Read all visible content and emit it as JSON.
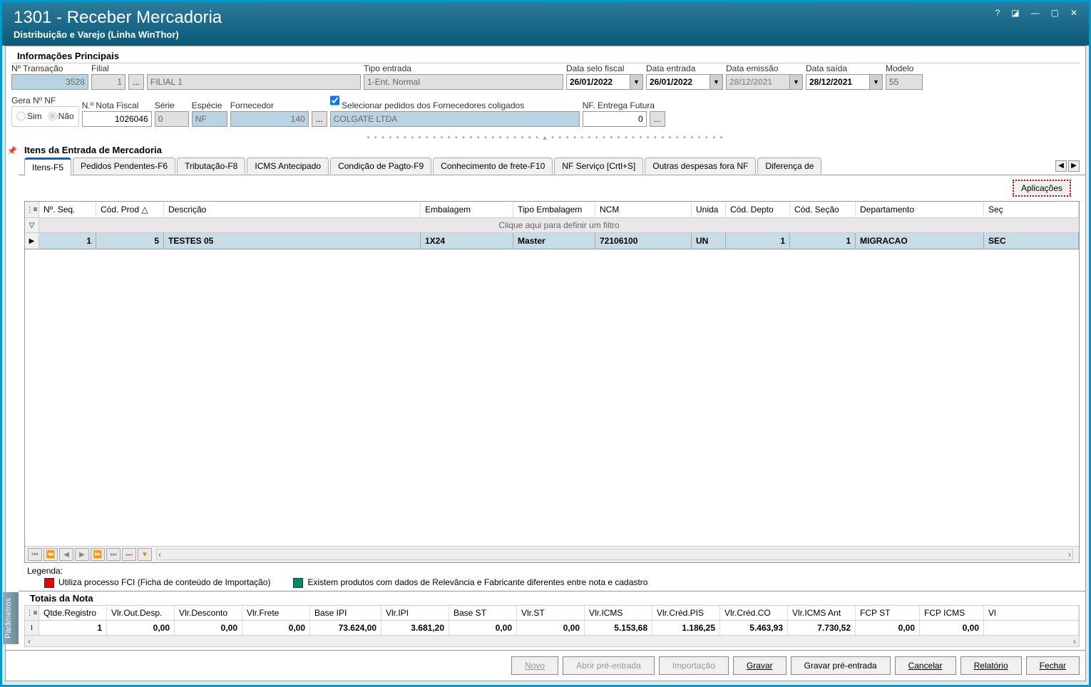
{
  "titlebar": {
    "title": "1301 - Receber Mercadoria",
    "subtitle": "Distribuição e Varejo (Linha WinThor)"
  },
  "info_principais": {
    "section_title": "Informações Principais",
    "labels": {
      "n_transacao": "Nº Transação",
      "filial": "Filial",
      "tipo_entrada": "Tipo entrada",
      "data_selo_fiscal": "Data selo fiscal",
      "data_entrada": "Data entrada",
      "data_emissao": "Data emissão",
      "data_saida": "Data saída",
      "modelo": "Modelo",
      "gera_nf": "Gera Nº NF",
      "sim": "Sim",
      "nao": "Não",
      "n_nota_fiscal": "N.º Nota Fiscal",
      "serie": "Série",
      "especie": "Espécie",
      "fornecedor": "Fornecedor",
      "selecionar_pedidos": "Selecionar pedidos dos Fornecedores coligados",
      "nf_entrega": "NF. Entrega Futura"
    },
    "values": {
      "n_transacao": "3528",
      "filial_cod": "1",
      "filial_nome": "FILIAL 1",
      "tipo_entrada": "1-Ent. Normal",
      "data_selo_fiscal": "26/01/2022",
      "data_entrada": "26/01/2022",
      "data_emissao": "28/12/2021",
      "data_saida": "28/12/2021",
      "modelo": "55",
      "n_nota_fiscal": "1026046",
      "serie": "0",
      "especie": "NF",
      "fornecedor_cod": "140",
      "fornecedor_nome": "COLGATE LTDA",
      "nf_entrega": "0"
    }
  },
  "sidebar": {
    "label": "Parâmetros"
  },
  "itens": {
    "section_title": "Itens da Entrada de Mercadoria",
    "tabs": [
      "Itens-F5",
      "Pedidos Pendentes-F6",
      "Tributação-F8",
      "ICMS Antecipado",
      "Condição de Pagto-F9",
      "Conhecimento de frete-F10",
      "NF Serviço [Crtl+S]",
      "Outras despesas fora NF",
      "Diferença de"
    ],
    "aplicacoes_btn": "Aplicações",
    "columns": [
      "Nº. Seq.",
      "Cód. Prod",
      "Descrição",
      "Embalagem",
      "Tipo Embalagem",
      "NCM",
      "Unida",
      "Cód. Depto",
      "Cód. Seção",
      "Departamento",
      "Seç"
    ],
    "sort_indicator": "△",
    "filter_hint": "Clique aqui para definir um filtro",
    "rows": [
      {
        "seq": "1",
        "cod_prod": "5",
        "descricao": "TESTES 05",
        "embalagem": "1X24",
        "tipo_embalagem": "Master",
        "ncm": "72106100",
        "unidade": "UN",
        "cod_depto": "1",
        "cod_secao": "1",
        "departamento": "MIGRACAO",
        "secao": "SEC"
      }
    ]
  },
  "legenda": {
    "title": "Legenda:",
    "fci": "Utiliza processo FCI (Ficha de conteúdo de Importação)",
    "relevancia": "Existem produtos com dados de Relevância e Fabricante diferentes entre nota e cadastro"
  },
  "totais": {
    "section_title": "Totais da Nota",
    "columns": [
      "Qtde.Registro",
      "Vlr.Out.Desp.",
      "Vlr.Desconto",
      "Vlr.Frete",
      "Base IPI",
      "Vlr.IPI",
      "Base ST",
      "Vlr.ST",
      "Vlr.ICMS",
      "Vlr.Créd.PIS",
      "Vlr.Créd.CO",
      "Vlr.ICMS Ant",
      "FCP ST",
      "FCP ICMS",
      "Vl"
    ],
    "values": [
      "1",
      "0,00",
      "0,00",
      "0,00",
      "73.624,00",
      "3.681,20",
      "0,00",
      "0,00",
      "5.153,68",
      "1.186,25",
      "5.463,93",
      "7.730,52",
      "0,00",
      "0,00",
      ""
    ]
  },
  "buttons": {
    "novo": "Novo",
    "abrir": "Abrir pré-entrada",
    "importacao": "Importação",
    "gravar": "Gravar",
    "gravar_pre": "Gravar pré-entrada",
    "cancelar": "Cancelar",
    "relatorio": "Relatório",
    "fechar": "Fechar"
  }
}
